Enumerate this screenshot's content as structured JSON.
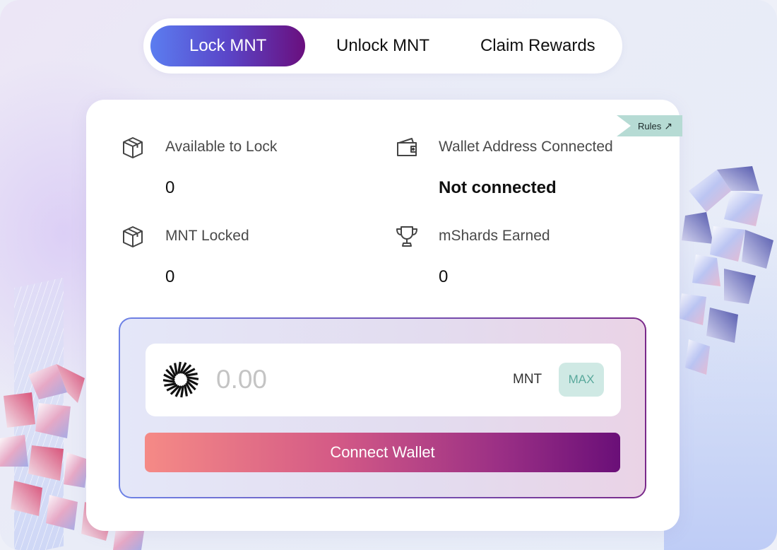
{
  "tabs": [
    {
      "label": "Lock MNT",
      "active": true
    },
    {
      "label": "Unlock MNT",
      "active": false
    },
    {
      "label": "Claim Rewards",
      "active": false
    }
  ],
  "rules": {
    "label": "Rules",
    "icon": "arrow-up-right-icon"
  },
  "stats": {
    "available": {
      "label": "Available to Lock",
      "value": "0",
      "icon": "cube-icon"
    },
    "wallet": {
      "label": "Wallet Address Connected",
      "value": "Not connected",
      "icon": "wallet-icon"
    },
    "locked": {
      "label": "MNT Locked",
      "value": "0",
      "icon": "cube-icon"
    },
    "earned": {
      "label": "mShards Earned",
      "value": "0",
      "icon": "trophy-icon"
    }
  },
  "amount": {
    "placeholder": "0.00",
    "value": "",
    "unit": "MNT",
    "max_label": "MAX",
    "token_icon": "mantle-logo-icon"
  },
  "connect_button": {
    "label": "Connect Wallet"
  },
  "colors": {
    "tab_active_start": "#5b7df0",
    "tab_active_end": "#6a0f7e",
    "connect_start": "#f58a86",
    "connect_end": "#6a0f78",
    "max_bg": "#cfe9e4",
    "max_text": "#5aa99c",
    "rules_bg": "#b6dbd4"
  }
}
